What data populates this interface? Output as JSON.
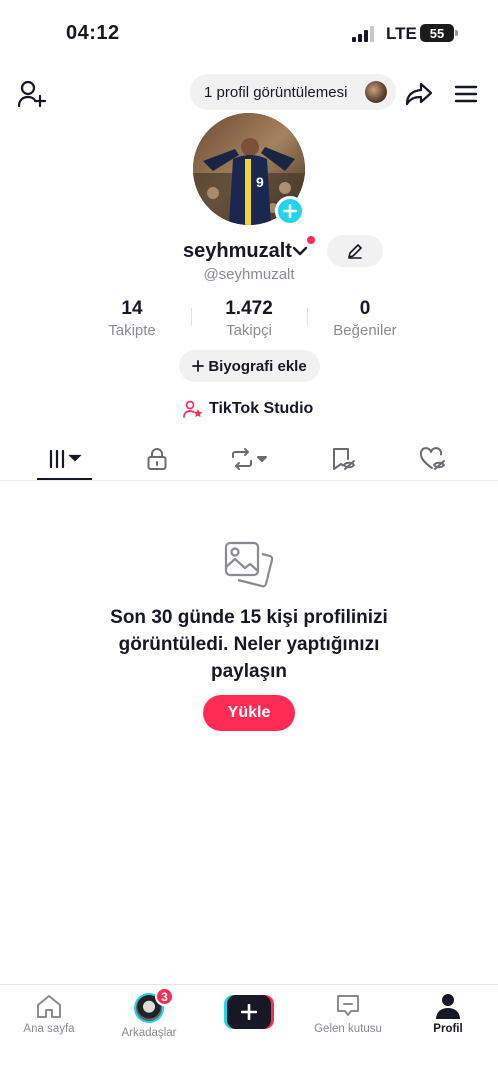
{
  "status_bar": {
    "time": "04:12",
    "network": "LTE",
    "battery": "55"
  },
  "top_nav": {
    "profile_views_label": "1 profil görüntülemesi"
  },
  "profile": {
    "username": "seyhmuzalt",
    "handle": "@seyhmuzalt"
  },
  "stats": [
    {
      "value": "14",
      "label": "Takipte"
    },
    {
      "value": "1.472",
      "label": "Takipçi"
    },
    {
      "value": "0",
      "label": "Beğeniler"
    }
  ],
  "actions": {
    "bio_label": "Biyografi ekle",
    "studio_label": "TikTok Studio"
  },
  "tabs": [
    {
      "name": "videos",
      "icon": "grid-icon",
      "active": true
    },
    {
      "name": "private",
      "icon": "lock-icon"
    },
    {
      "name": "reposts",
      "icon": "repost-icon"
    },
    {
      "name": "favorites",
      "icon": "bookmark-icon"
    },
    {
      "name": "liked",
      "icon": "heart-hidden-icon"
    }
  ],
  "empty_state": {
    "message": "Son 30 günde 15 kişi profilinizi görüntüledi. Neler yaptığınızı paylaşın",
    "upload_label": "Yükle"
  },
  "bottom_nav": {
    "home_label": "Ana sayfa",
    "friends_label": "Arkadaşlar",
    "friends_badge": "3",
    "inbox_label": "Gelen kutusu",
    "profile_label": "Profil"
  },
  "colors": {
    "accent_red": "#fe2c55",
    "accent_cyan": "#20d5ec",
    "text_primary": "#161823",
    "text_secondary": "#8a8b91"
  }
}
